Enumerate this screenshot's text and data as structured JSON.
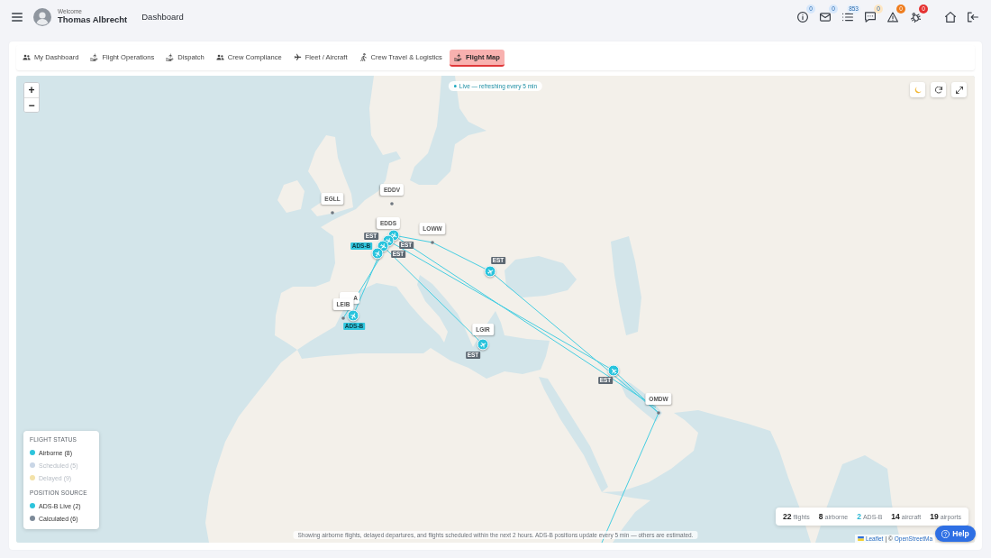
{
  "header": {
    "user": {
      "greeting": "Welcome",
      "name": "Thomas Albrecht"
    },
    "page_title": "Dashboard",
    "notifications": [
      {
        "badge": "0",
        "color": "#d6e7fb"
      },
      {
        "badge": "0",
        "color": "#d6e7fb"
      },
      {
        "badge": "853",
        "color": "#e6f0fc"
      },
      {
        "badge": "0",
        "color": "#fde6c4"
      },
      {
        "badge": "0",
        "color": "#ef7d1f"
      },
      {
        "badge": "0",
        "color": "#e53232"
      }
    ]
  },
  "tabs": [
    {
      "label": "My Dashboard",
      "selected": false
    },
    {
      "label": "Flight Operations",
      "selected": false
    },
    {
      "label": "Dispatch",
      "selected": false
    },
    {
      "label": "Crew Compliance",
      "selected": false
    },
    {
      "label": "Fleet / Aircraft",
      "selected": false
    },
    {
      "label": "Crew Travel & Logistics",
      "selected": false
    },
    {
      "label": "Flight Map",
      "selected": true
    }
  ],
  "map": {
    "zoom_controls": [
      "+",
      "−"
    ],
    "live_status": "Live — refreshing every 5 min",
    "airports": [
      {
        "code": "EGLL"
      },
      {
        "code": "EDDV"
      },
      {
        "code": "EDDS"
      },
      {
        "code": "LOWW"
      },
      {
        "code": "A"
      },
      {
        "code": "LEIB"
      },
      {
        "code": "LGIR"
      },
      {
        "code": "OMDW"
      }
    ],
    "flights": [
      {
        "tag": "EST",
        "kind": "calculated"
      },
      {
        "tag": "EST",
        "kind": "calculated"
      },
      {
        "tag": "ADS-B",
        "kind": "adsb"
      },
      {
        "tag": "EST",
        "kind": "calculated"
      },
      {
        "tag": "EST",
        "kind": "calculated"
      },
      {
        "tag": "ADS-B",
        "kind": "adsb"
      },
      {
        "tag": "EST",
        "kind": "calculated"
      },
      {
        "tag": "EST",
        "kind": "calculated"
      }
    ],
    "legend": {
      "sections": [
        {
          "title": "FLIGHT STATUS",
          "items": [
            {
              "label": "Airborne (8)",
              "color": "#2cc4dc",
              "active": true
            },
            {
              "label": "Scheduled (5)",
              "color": "#c9d6e6",
              "active": false
            },
            {
              "label": "Delayed (9)",
              "color": "#f3e2a9",
              "active": false
            }
          ]
        },
        {
          "title": "POSITION SOURCE",
          "items": [
            {
              "label": "ADS-B Live (2)",
              "color": "#2cc4dc",
              "active": true
            },
            {
              "label": "Calculated (6)",
              "color": "#7d8a98",
              "active": true
            }
          ]
        }
      ]
    },
    "stats": [
      {
        "count": "22",
        "unit": "flights"
      },
      {
        "count": "8",
        "unit": "airborne"
      },
      {
        "count": "2",
        "unit": "ADS-B",
        "color": "#2bb7d4"
      },
      {
        "count": "14",
        "unit": "aircraft"
      },
      {
        "count": "19",
        "unit": "airports"
      }
    ],
    "note": "Showing airborne flights, delayed departures, and flights scheduled within the next 2 hours. ADS-B positions update every 5 min — others are estimated.",
    "attribution": {
      "links": [
        "Leaflet",
        "OpenStreetMa"
      ],
      "separator": "| ©"
    }
  },
  "help_button": {
    "label": "Help"
  }
}
